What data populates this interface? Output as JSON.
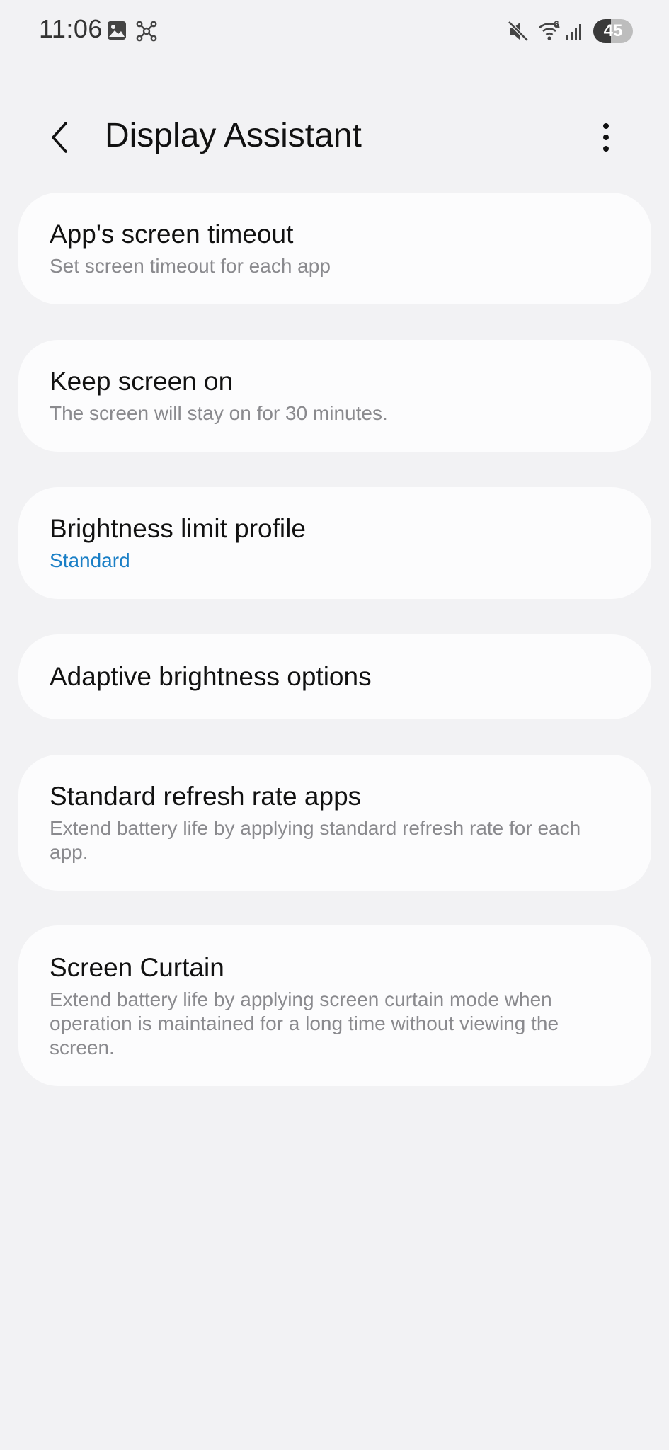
{
  "status_bar": {
    "time": "11:06",
    "battery_level": "45",
    "battery_fraction": 0.45,
    "network_label": "6",
    "icons": [
      "gallery-icon",
      "network-share-icon",
      "mute-icon",
      "wifi-icon",
      "signal-icon"
    ]
  },
  "header": {
    "title": "Display Assistant",
    "back_icon": "chevron-left-icon",
    "more_icon": "more-vertical-icon"
  },
  "items": [
    {
      "title": "App's screen timeout",
      "subtitle": "Set screen timeout for each app"
    },
    {
      "title": "Keep screen on",
      "subtitle": "The screen will stay on for 30 minutes."
    },
    {
      "title": "Brightness limit profile",
      "subtitle": "Standard"
    },
    {
      "title": "Adaptive brightness options"
    },
    {
      "title": "Standard refresh rate apps",
      "subtitle": "Extend battery life by applying standard refresh rate for each app."
    },
    {
      "title": "Screen Curtain",
      "subtitle": "Extend battery life by applying screen curtain mode when operation is maintained for a long time without viewing the screen."
    }
  ],
  "colors": {
    "background": "#f2f2f4",
    "card": "#fcfcfd",
    "accent": "#1a7fc6",
    "subtitle": "#8a8a8e"
  }
}
